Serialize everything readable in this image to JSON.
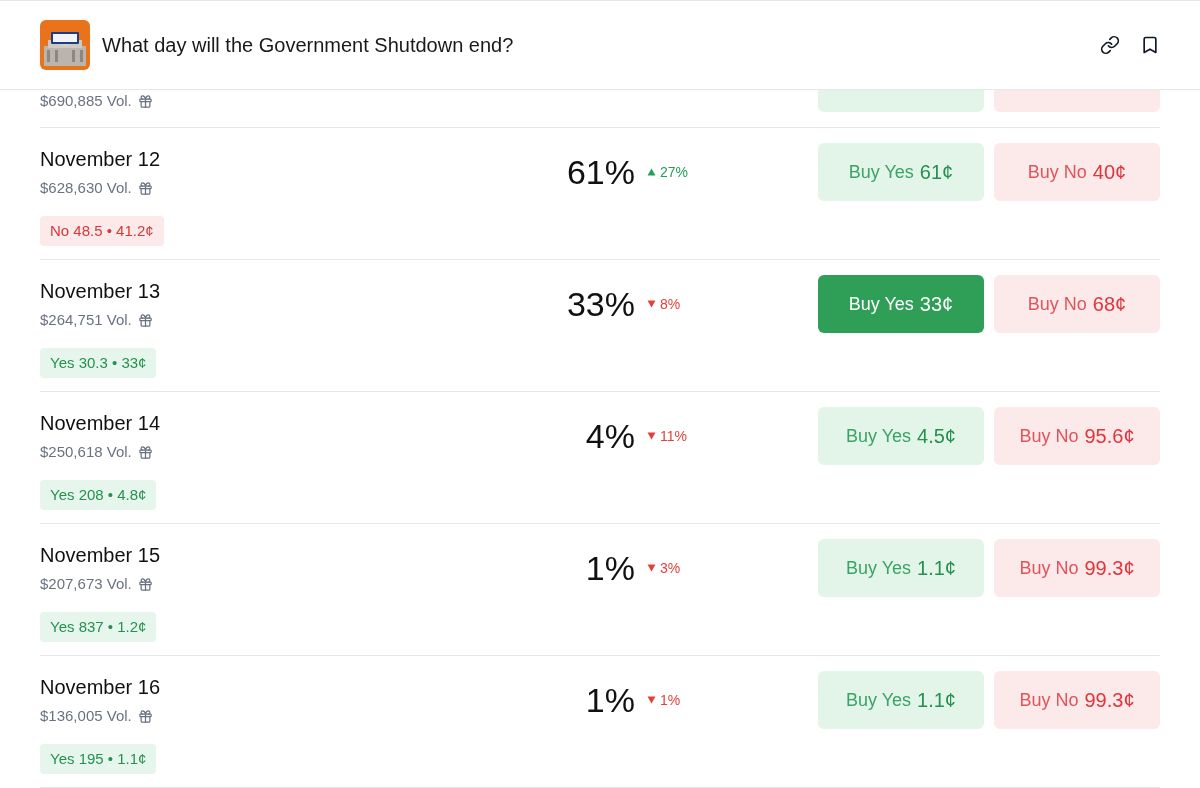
{
  "header": {
    "title": "What day will the Government Shutdown end?"
  },
  "partial_row": {
    "volume": "$690,885 Vol."
  },
  "rows": [
    {
      "date": "November 12",
      "volume": "$628,630 Vol.",
      "chance": "61%",
      "change": {
        "kind": "up",
        "value": "27%"
      },
      "yes": {
        "label": "Buy Yes",
        "price": "61¢",
        "selected": false
      },
      "no": {
        "label": "Buy No",
        "price": "40¢",
        "selected": false
      },
      "position": {
        "kind": "no",
        "text": "No 48.5 • 41.2¢"
      }
    },
    {
      "date": "November 13",
      "volume": "$264,751 Vol.",
      "chance": "33%",
      "change": {
        "kind": "down",
        "value": "8%"
      },
      "yes": {
        "label": "Buy Yes",
        "price": "33¢",
        "selected": true
      },
      "no": {
        "label": "Buy No",
        "price": "68¢",
        "selected": false
      },
      "position": {
        "kind": "yes",
        "text": "Yes 30.3 • 33¢"
      }
    },
    {
      "date": "November 14",
      "volume": "$250,618 Vol.",
      "chance": "4%",
      "change": {
        "kind": "down",
        "value": "11%"
      },
      "yes": {
        "label": "Buy Yes",
        "price": "4.5¢",
        "selected": false
      },
      "no": {
        "label": "Buy No",
        "price": "95.6¢",
        "selected": false
      },
      "position": {
        "kind": "yes",
        "text": "Yes 208 • 4.8¢"
      }
    },
    {
      "date": "November 15",
      "volume": "$207,673 Vol.",
      "chance": "1%",
      "change": {
        "kind": "down",
        "value": "3%"
      },
      "yes": {
        "label": "Buy Yes",
        "price": "1.1¢",
        "selected": false
      },
      "no": {
        "label": "Buy No",
        "price": "99.3¢",
        "selected": false
      },
      "position": {
        "kind": "yes",
        "text": "Yes 837 • 1.2¢"
      }
    },
    {
      "date": "November 16",
      "volume": "$136,005 Vol.",
      "chance": "1%",
      "change": {
        "kind": "down",
        "value": "1%"
      },
      "yes": {
        "label": "Buy Yes",
        "price": "1.1¢",
        "selected": false
      },
      "no": {
        "label": "Buy No",
        "price": "99.3¢",
        "selected": false
      },
      "position": {
        "kind": "yes",
        "text": "Yes 195 • 1.1¢"
      }
    }
  ]
}
